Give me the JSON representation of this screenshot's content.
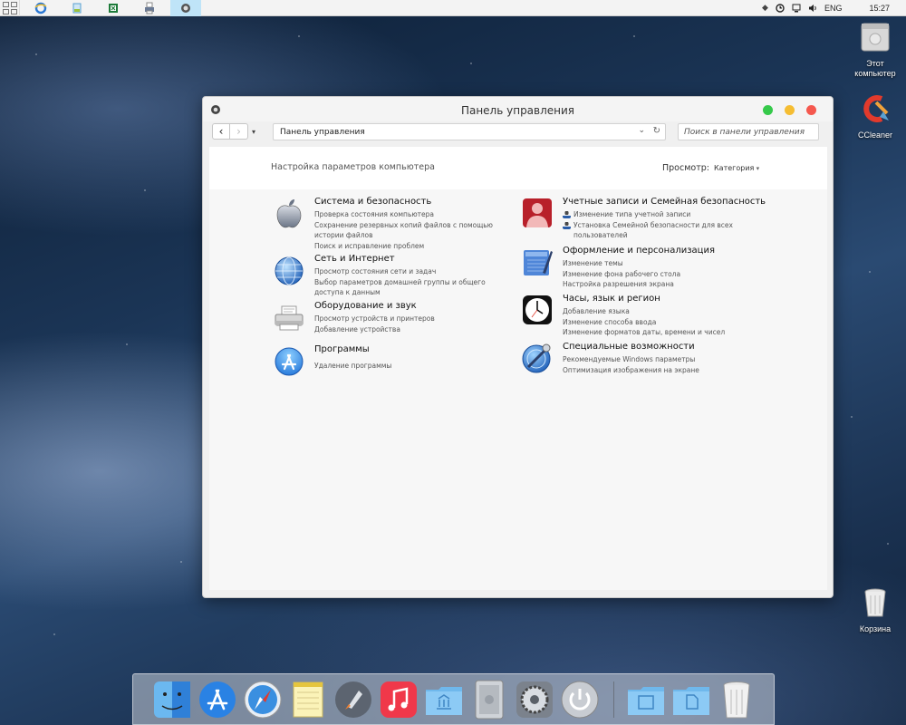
{
  "taskbar": {
    "apps": [
      {
        "name": "ie-icon",
        "color": "#2b78d4"
      },
      {
        "name": "paint-icon",
        "color": "#5aa0d0"
      },
      {
        "name": "excel-icon",
        "color": "#1e7b3a"
      },
      {
        "name": "printer-icon",
        "color": "#6a7a95"
      },
      {
        "name": "control-panel-icon",
        "color": "#555555",
        "active": true
      }
    ],
    "tray": {
      "language": "ENG",
      "time": "15:27"
    }
  },
  "desktop": {
    "icons": [
      {
        "label": "Этот компьютер"
      },
      {
        "label": "CCleaner"
      },
      {
        "label": "Корзина"
      }
    ]
  },
  "window": {
    "title": "Панель управления",
    "address": "Панель управления",
    "search_placeholder": "Поиск в панели управления",
    "subtitle": "Настройка параметров компьютера",
    "view_label": "Просмотр:",
    "view_value": "Категория",
    "traffic_colors": {
      "green": "#35c94a",
      "yellow": "#f5bd32",
      "red": "#f5584e"
    }
  },
  "categories_left": [
    {
      "title": "Система и безопасность",
      "icon": "apple-icon",
      "links": [
        "Проверка состояния компьютера",
        "Сохранение резервных копий файлов с помощью истории файлов",
        "Поиск и исправление проблем"
      ]
    },
    {
      "title": "Сеть и Интернет",
      "icon": "globe-icon",
      "links": [
        "Просмотр состояния сети и задач",
        "Выбор параметров домашней группы и общего доступа к данным"
      ]
    },
    {
      "title": "Оборудование и звук",
      "icon": "printer-icon",
      "links": [
        "Просмотр устройств и принтеров",
        "Добавление устройства"
      ]
    },
    {
      "title": "Программы",
      "icon": "app-store-icon",
      "links": [
        "Удаление программы"
      ]
    }
  ],
  "categories_right": [
    {
      "title": "Учетные записи и Семейная безопасность",
      "icon": "user-accounts-icon",
      "links": [
        "Изменение типа учетной записи",
        "Установка Семейной безопасности для всех пользователей"
      ]
    },
    {
      "title": "Оформление и персонализация",
      "icon": "personalization-icon",
      "links": [
        "Изменение темы",
        "Изменение фона рабочего стола",
        "Настройка разрешения экрана"
      ]
    },
    {
      "title": "Часы, язык и регион",
      "icon": "clock-icon",
      "links": [
        "Добавление языка",
        "Изменение способа ввода",
        "Изменение форматов даты, времени и чисел"
      ]
    },
    {
      "title": "Специальные возможности",
      "icon": "accessibility-icon",
      "links": [
        "Рекомендуемые Windows параметры",
        "Оптимизация изображения на экране"
      ]
    }
  ],
  "dock": {
    "items": [
      {
        "name": "finder-icon"
      },
      {
        "name": "app-store-dock-icon"
      },
      {
        "name": "safari-icon"
      },
      {
        "name": "notes-icon"
      },
      {
        "name": "launchpad-icon"
      },
      {
        "name": "itunes-icon"
      },
      {
        "name": "applications-folder-icon"
      },
      {
        "name": "mac-pro-icon"
      },
      {
        "name": "system-preferences-icon"
      },
      {
        "name": "power-icon"
      },
      {
        "name": "documents-folder-icon"
      },
      {
        "name": "downloads-folder-icon"
      },
      {
        "name": "trash-icon"
      }
    ]
  }
}
